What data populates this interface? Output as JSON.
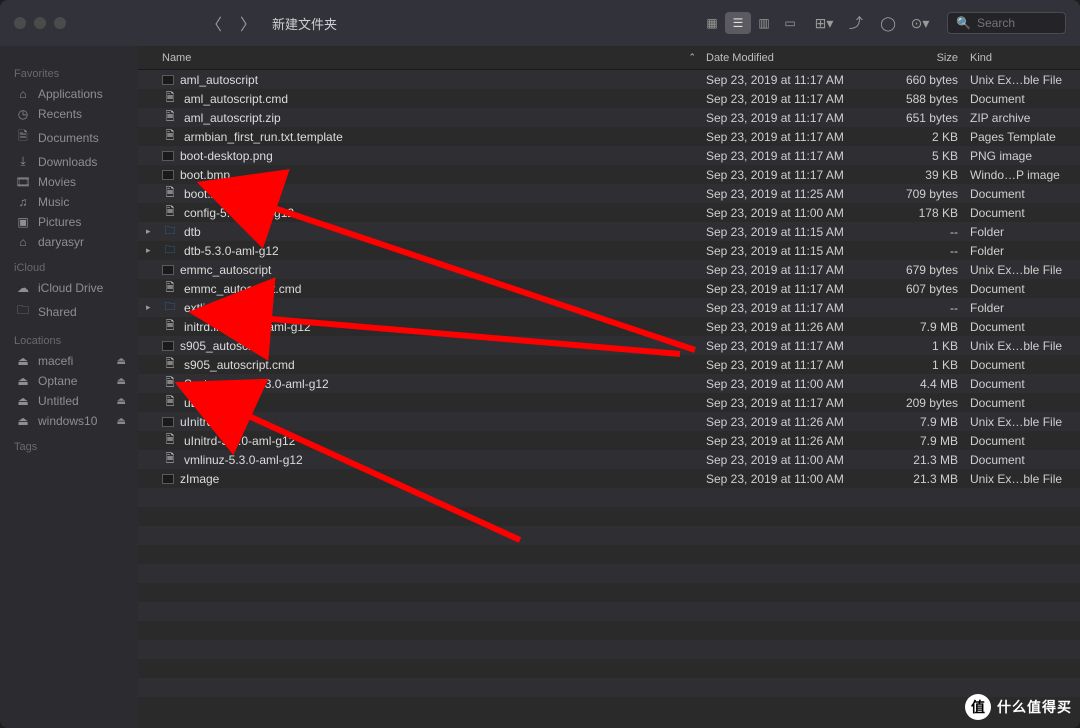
{
  "toolbar": {
    "title": "新建文件夹",
    "search_placeholder": "Search"
  },
  "sidebar": {
    "sections": [
      {
        "header": "Favorites",
        "items": [
          {
            "icon": "⌂",
            "label": "Applications"
          },
          {
            "icon": "◷",
            "label": "Recents"
          },
          {
            "icon": "🗎",
            "label": "Documents"
          },
          {
            "icon": "⤓",
            "label": "Downloads"
          },
          {
            "icon": "🎞",
            "label": "Movies"
          },
          {
            "icon": "♫",
            "label": "Music"
          },
          {
            "icon": "▣",
            "label": "Pictures"
          },
          {
            "icon": "⌂",
            "label": "daryasyr"
          }
        ]
      },
      {
        "header": "iCloud",
        "items": [
          {
            "icon": "☁",
            "label": "iCloud Drive"
          },
          {
            "icon": "🗀",
            "label": "Shared"
          }
        ]
      },
      {
        "header": "Locations",
        "items": [
          {
            "icon": "⏏",
            "label": "macefi",
            "eject": true
          },
          {
            "icon": "⏏",
            "label": "Optane",
            "eject": true
          },
          {
            "icon": "⏏",
            "label": "Untitled",
            "eject": true
          },
          {
            "icon": "⏏",
            "label": "windows10",
            "eject": true
          }
        ]
      },
      {
        "header": "Tags",
        "items": []
      }
    ]
  },
  "columns": {
    "name": "Name",
    "date": "Date Modified",
    "size": "Size",
    "kind": "Kind"
  },
  "files": [
    {
      "icon": "exe",
      "name": "aml_autoscript",
      "date": "Sep 23, 2019 at 11:17 AM",
      "size": "660 bytes",
      "kind": "Unix Ex…ble File"
    },
    {
      "icon": "doc",
      "name": "aml_autoscript.cmd",
      "date": "Sep 23, 2019 at 11:17 AM",
      "size": "588 bytes",
      "kind": "Document"
    },
    {
      "icon": "doc",
      "name": "aml_autoscript.zip",
      "date": "Sep 23, 2019 at 11:17 AM",
      "size": "651 bytes",
      "kind": "ZIP archive"
    },
    {
      "icon": "doc",
      "name": "armbian_first_run.txt.template",
      "date": "Sep 23, 2019 at 11:17 AM",
      "size": "2 KB",
      "kind": "Pages Template"
    },
    {
      "icon": "exe",
      "name": "boot-desktop.png",
      "date": "Sep 23, 2019 at 11:17 AM",
      "size": "5 KB",
      "kind": "PNG image"
    },
    {
      "icon": "exe",
      "name": "boot.bmp",
      "date": "Sep 23, 2019 at 11:17 AM",
      "size": "39 KB",
      "kind": "Windo…P image"
    },
    {
      "icon": "doc",
      "name": "boot.ini",
      "date": "Sep 23, 2019 at 11:25 AM",
      "size": "709 bytes",
      "kind": "Document"
    },
    {
      "icon": "doc",
      "name": "config-5.3.0-aml-g12",
      "date": "Sep 23, 2019 at 11:00 AM",
      "size": "178 KB",
      "kind": "Document"
    },
    {
      "icon": "folder",
      "name": "dtb",
      "date": "Sep 23, 2019 at 11:15 AM",
      "size": "--",
      "kind": "Folder",
      "expandable": true
    },
    {
      "icon": "folder",
      "name": "dtb-5.3.0-aml-g12",
      "date": "Sep 23, 2019 at 11:15 AM",
      "size": "--",
      "kind": "Folder",
      "expandable": true
    },
    {
      "icon": "exe",
      "name": "emmc_autoscript",
      "date": "Sep 23, 2019 at 11:17 AM",
      "size": "679 bytes",
      "kind": "Unix Ex…ble File"
    },
    {
      "icon": "doc",
      "name": "emmc_autoscript.cmd",
      "date": "Sep 23, 2019 at 11:17 AM",
      "size": "607 bytes",
      "kind": "Document"
    },
    {
      "icon": "folder",
      "name": "extlinux",
      "date": "Sep 23, 2019 at 11:17 AM",
      "size": "--",
      "kind": "Folder",
      "expandable": true
    },
    {
      "icon": "doc",
      "name": "initrd.img-5.3.0-aml-g12",
      "date": "Sep 23, 2019 at 11:26 AM",
      "size": "7.9 MB",
      "kind": "Document"
    },
    {
      "icon": "exe",
      "name": "s905_autoscript",
      "date": "Sep 23, 2019 at 11:17 AM",
      "size": "1 KB",
      "kind": "Unix Ex…ble File"
    },
    {
      "icon": "doc",
      "name": "s905_autoscript.cmd",
      "date": "Sep 23, 2019 at 11:17 AM",
      "size": "1 KB",
      "kind": "Document"
    },
    {
      "icon": "doc",
      "name": "System.map-5.3.0-aml-g12",
      "date": "Sep 23, 2019 at 11:00 AM",
      "size": "4.4 MB",
      "kind": "Document"
    },
    {
      "icon": "doc",
      "name": "uEnv.ini",
      "date": "Sep 23, 2019 at 11:17 AM",
      "size": "209 bytes",
      "kind": "Document"
    },
    {
      "icon": "exe",
      "name": "uInitrd",
      "date": "Sep 23, 2019 at 11:26 AM",
      "size": "7.9 MB",
      "kind": "Unix Ex…ble File"
    },
    {
      "icon": "doc",
      "name": "uInitrd-5.3.0-aml-g12",
      "date": "Sep 23, 2019 at 11:26 AM",
      "size": "7.9 MB",
      "kind": "Document"
    },
    {
      "icon": "doc",
      "name": "vmlinuz-5.3.0-aml-g12",
      "date": "Sep 23, 2019 at 11:00 AM",
      "size": "21.3 MB",
      "kind": "Document"
    },
    {
      "icon": "exe",
      "name": "zImage",
      "date": "Sep 23, 2019 at 11:00 AM",
      "size": "21.3 MB",
      "kind": "Unix Ex…ble File"
    }
  ],
  "watermark": {
    "badge": "值",
    "text": "什么值得买"
  }
}
